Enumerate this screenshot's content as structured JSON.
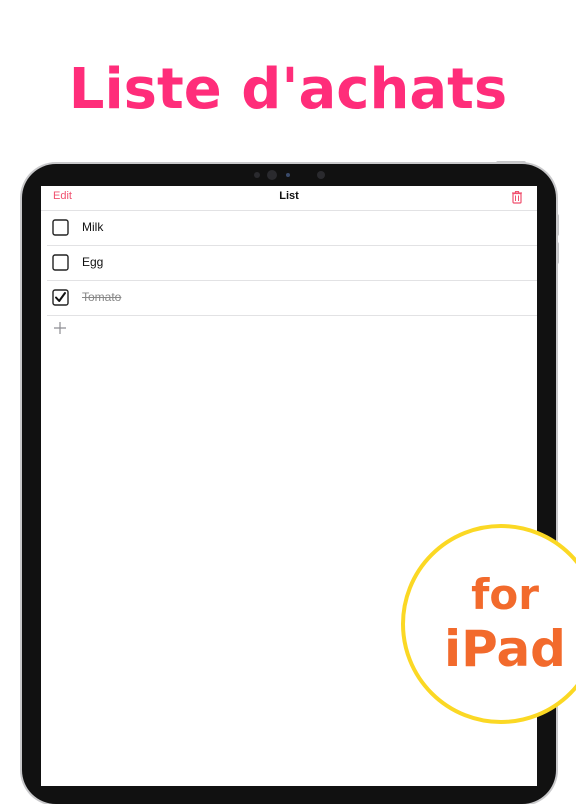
{
  "headline": "Liste d'achats",
  "navbar": {
    "edit_label": "Edit",
    "title": "List",
    "trash_icon": "trash-icon"
  },
  "items": [
    {
      "label": "Milk",
      "checked": false
    },
    {
      "label": "Egg",
      "checked": false
    },
    {
      "label": "Tomato",
      "checked": true
    }
  ],
  "add_icon": "plus-icon",
  "badge": {
    "line1": "for",
    "line2": "iPad"
  },
  "colors": {
    "headline": "#ff2d7a",
    "accent": "#f0516f",
    "badge_text": "#f26a2c",
    "badge_ring": "#fbd824"
  }
}
